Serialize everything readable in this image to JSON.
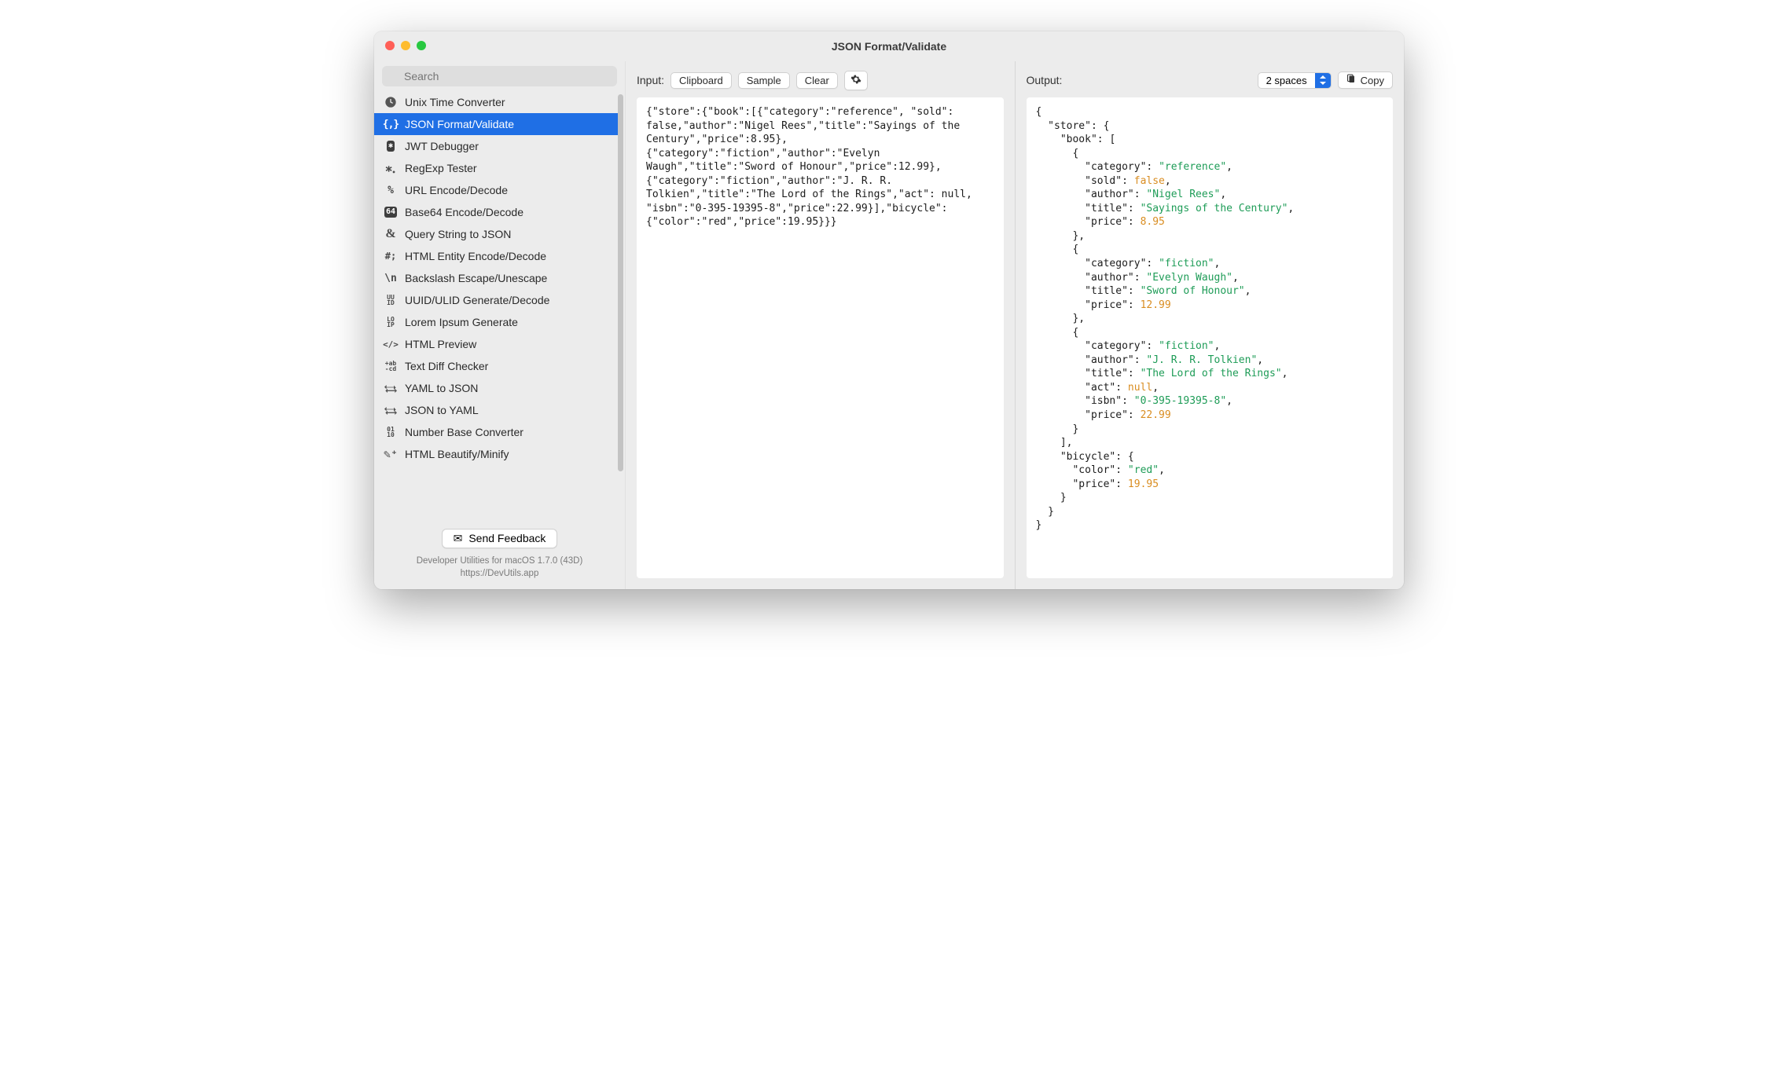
{
  "window": {
    "title": "JSON Format/Validate"
  },
  "search": {
    "placeholder": "Search"
  },
  "sidebar": {
    "items": [
      {
        "label": "Unix Time Converter"
      },
      {
        "label": "JSON Format/Validate"
      },
      {
        "label": "JWT Debugger"
      },
      {
        "label": "RegExp Tester"
      },
      {
        "label": "URL Encode/Decode"
      },
      {
        "label": "Base64 Encode/Decode"
      },
      {
        "label": "Query String to JSON"
      },
      {
        "label": "HTML Entity Encode/Decode"
      },
      {
        "label": "Backslash Escape/Unescape"
      },
      {
        "label": "UUID/ULID Generate/Decode"
      },
      {
        "label": "Lorem Ipsum Generate"
      },
      {
        "label": "HTML Preview"
      },
      {
        "label": "Text Diff Checker"
      },
      {
        "label": "YAML to JSON"
      },
      {
        "label": "JSON to YAML"
      },
      {
        "label": "Number Base Converter"
      },
      {
        "label": "HTML Beautify/Minify"
      }
    ],
    "active_index": 1,
    "feedback_label": "Send Feedback",
    "footer_line1": "Developer Utilities for macOS 1.7.0 (43D)",
    "footer_line2": "https://DevUtils.app"
  },
  "input": {
    "label": "Input:",
    "buttons": {
      "clipboard": "Clipboard",
      "sample": "Sample",
      "clear": "Clear"
    },
    "text": "{\"store\":{\"book\":[{\"category\":\"reference\", \"sold\": false,\"author\":\"Nigel Rees\",\"title\":\"Sayings of the Century\",\"price\":8.95},{\"category\":\"fiction\",\"author\":\"Evelyn Waugh\",\"title\":\"Sword of Honour\",\"price\":12.99},{\"category\":\"fiction\",\"author\":\"J. R. R. Tolkien\",\"title\":\"The Lord of the Rings\",\"act\": null, \"isbn\":\"0-395-19395-8\",\"price\":22.99}],\"bicycle\":{\"color\":\"red\",\"price\":19.95}}}"
  },
  "output": {
    "label": "Output:",
    "indent_option": "2 spaces",
    "copy_label": "Copy",
    "json": {
      "store": {
        "book": [
          {
            "category": "reference",
            "sold": false,
            "author": "Nigel Rees",
            "title": "Sayings of the Century",
            "price": 8.95
          },
          {
            "category": "fiction",
            "author": "Evelyn Waugh",
            "title": "Sword of Honour",
            "price": 12.99
          },
          {
            "category": "fiction",
            "author": "J. R. R. Tolkien",
            "title": "The Lord of the Rings",
            "act": null,
            "isbn": "0-395-19395-8",
            "price": 22.99
          }
        ],
        "bicycle": {
          "color": "red",
          "price": 19.95
        }
      }
    }
  },
  "icons": {
    "unix": "🕐",
    "json": "{,}",
    "jwt": "✳",
    "regexp": "⁎",
    "url": "%",
    "b64": "64",
    "query": "&",
    "htmlent": "#;",
    "backslash": "\\n",
    "uuid": "UU\nID",
    "lorem": "LO\nIP",
    "htmlprev": "</>",
    "diff": "+ab\n-cd",
    "yaml2json": "⇄",
    "json2yaml": "⇄",
    "base": "01\n10",
    "beautify": "✎"
  }
}
